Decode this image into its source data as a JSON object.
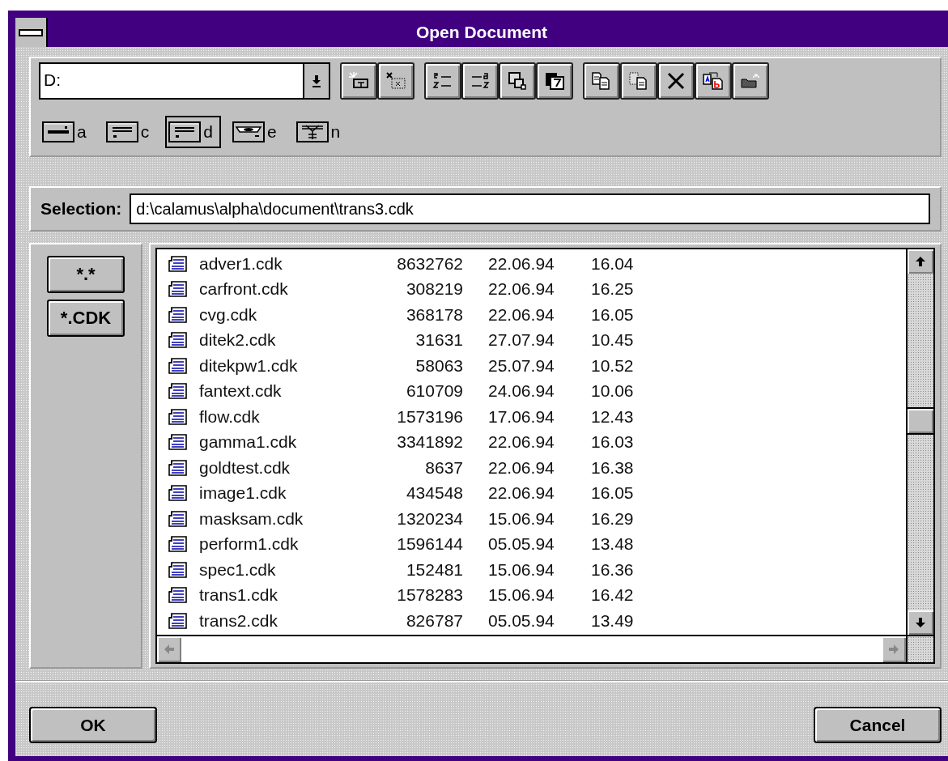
{
  "window": {
    "title": "Open Document"
  },
  "drive_combo": {
    "value": "D:"
  },
  "drives": [
    {
      "letter": "a",
      "kind": "floppy",
      "selected": false
    },
    {
      "letter": "c",
      "kind": "hdd",
      "selected": false
    },
    {
      "letter": "d",
      "kind": "hdd",
      "selected": true
    },
    {
      "letter": "e",
      "kind": "cdrom",
      "selected": false
    },
    {
      "letter": "n",
      "kind": "network",
      "selected": false
    }
  ],
  "selection": {
    "label": "Selection:",
    "value": "d:\\calamus\\alpha\\document\\trans3.cdk"
  },
  "filters": [
    "*.*",
    "*.CDK"
  ],
  "files": [
    {
      "name": "adver1.cdk",
      "size": "8632762",
      "date": "22.06.94",
      "time": "16.04"
    },
    {
      "name": "carfront.cdk",
      "size": "308219",
      "date": "22.06.94",
      "time": "16.25"
    },
    {
      "name": "cvg.cdk",
      "size": "368178",
      "date": "22.06.94",
      "time": "16.05"
    },
    {
      "name": "ditek2.cdk",
      "size": "31631",
      "date": "27.07.94",
      "time": "10.45"
    },
    {
      "name": "ditekpw1.cdk",
      "size": "58063",
      "date": "25.07.94",
      "time": "10.52"
    },
    {
      "name": "fantext.cdk",
      "size": "610709",
      "date": "24.06.94",
      "time": "10.06"
    },
    {
      "name": "flow.cdk",
      "size": "1573196",
      "date": "17.06.94",
      "time": "12.43"
    },
    {
      "name": "gamma1.cdk",
      "size": "3341892",
      "date": "22.06.94",
      "time": "16.03"
    },
    {
      "name": "goldtest.cdk",
      "size": "8637",
      "date": "22.06.94",
      "time": "16.38"
    },
    {
      "name": "image1.cdk",
      "size": "434548",
      "date": "22.06.94",
      "time": "16.05"
    },
    {
      "name": "masksam.cdk",
      "size": "1320234",
      "date": "15.06.94",
      "time": "16.29"
    },
    {
      "name": "perform1.cdk",
      "size": "1596144",
      "date": "05.05.94",
      "time": "13.48"
    },
    {
      "name": "spec1.cdk",
      "size": "152481",
      "date": "15.06.94",
      "time": "16.36"
    },
    {
      "name": "trans1.cdk",
      "size": "1578283",
      "date": "15.06.94",
      "time": "16.42"
    },
    {
      "name": "trans2.cdk",
      "size": "826787",
      "date": "05.05.94",
      "time": "13.49"
    }
  ],
  "buttons": {
    "ok": "OK",
    "cancel": "Cancel"
  }
}
